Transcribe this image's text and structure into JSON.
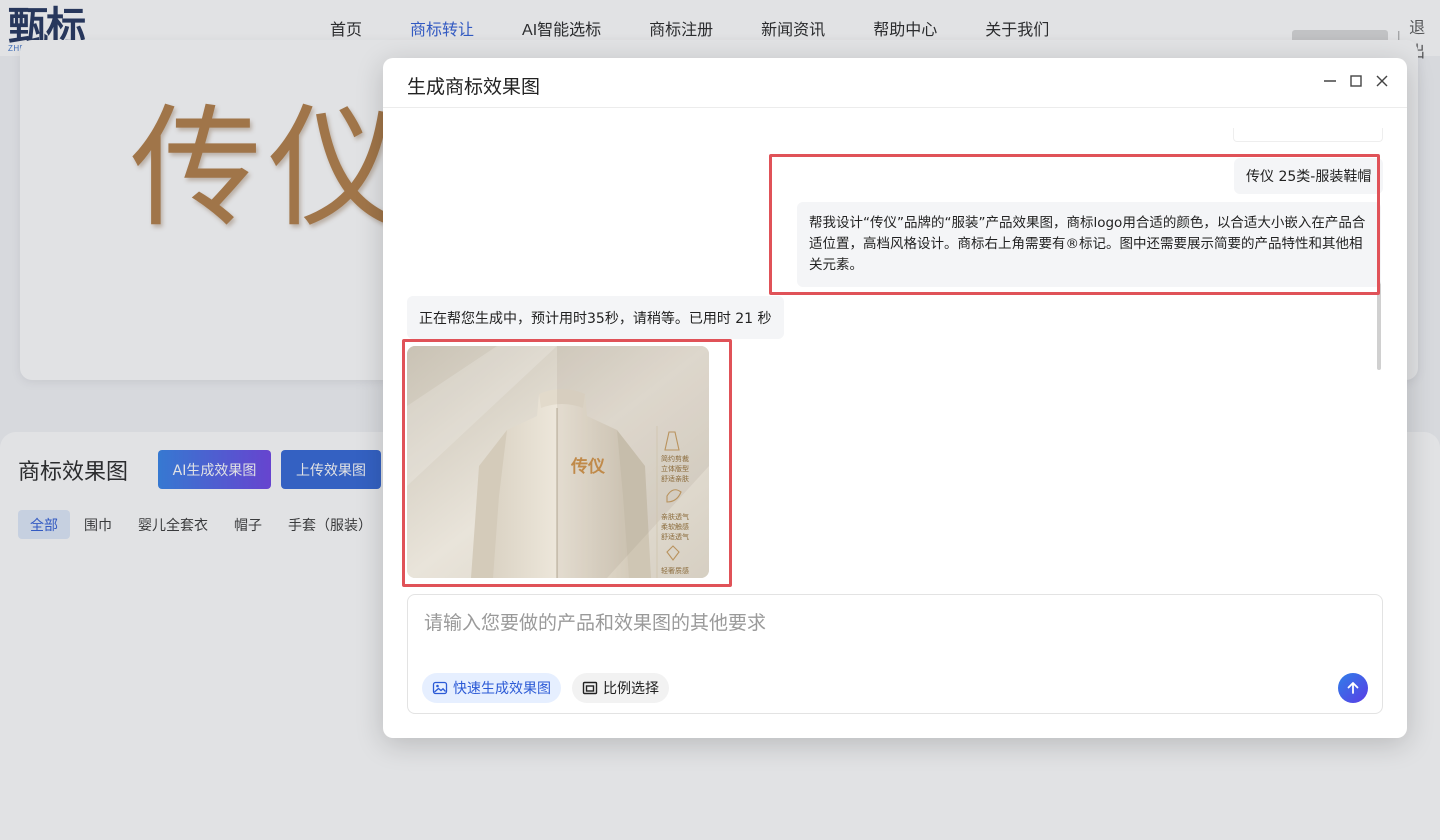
{
  "site": {
    "logo_text": "甄标",
    "logo_sub": "ZHENBIAOW.COM",
    "nav": [
      {
        "label": "首页"
      },
      {
        "label": "商标转让"
      },
      {
        "label": "AI智能选标"
      },
      {
        "label": "商标注册"
      },
      {
        "label": "新闻资讯"
      },
      {
        "label": "帮助中心"
      },
      {
        "label": "关于我们"
      }
    ],
    "active_nav": "商标转让",
    "logout_label": "退出",
    "brand_preview": "传仪"
  },
  "effects_panel": {
    "title": "商标效果图",
    "ai_button": "AI生成效果图",
    "upload_button": "上传效果图",
    "filters": [
      "全部",
      "围巾",
      "婴儿全套衣",
      "帽子",
      "手套（服装）"
    ],
    "active_filter": "全部"
  },
  "modal": {
    "title": "生成商标效果图",
    "messages": {
      "tag": "传仪 25类-服装鞋帽",
      "request": "帮我设计“传仪”品牌的“服装”产品效果图，商标logo用合适的颜色，以合适大小嵌入在产品合适位置，高档风格设计。商标右上角需要有®标记。图中还需要展示简要的产品特性和其他相关元素。",
      "status": "正在帮您生成中，预计用时35秒，请稍等。已用时 21 秒"
    },
    "image": {
      "brand_on_garment": "传仪",
      "features": [
        "简约剪裁",
        "立体版型",
        "舒适亲肤",
        "亲肤透气",
        "柔软触感",
        "舒适透气",
        "轻奢质感"
      ]
    },
    "input": {
      "placeholder": "请输入您要做的产品和效果图的其他要求"
    },
    "chips": {
      "quick": "快速生成效果图",
      "ratio": "比例选择"
    }
  },
  "colors": {
    "accent": "#2b5ad6",
    "highlight": "#e05258",
    "brand_gold": "#b07a42"
  }
}
